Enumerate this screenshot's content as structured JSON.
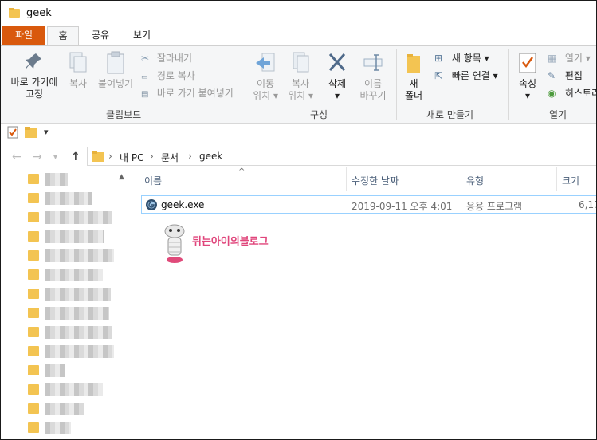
{
  "window": {
    "title": "geek"
  },
  "tabs": {
    "file": "파일",
    "home": "홈",
    "share": "공유",
    "view": "보기"
  },
  "ribbon": {
    "clipboard": {
      "pin_line1": "바로 가기에",
      "pin_line2": "고정",
      "copy": "복사",
      "paste": "붙여넣기",
      "cut": "잘라내기",
      "copy_path": "경로 복사",
      "paste_shortcut": "바로 가기 붙여넣기",
      "label": "클립보드"
    },
    "organize": {
      "move_line1": "이동",
      "move_line2": "위치",
      "copyto_line1": "복사",
      "copyto_line2": "위치",
      "delete": "삭제",
      "rename_line1": "이름",
      "rename_line2": "바꾸기",
      "label": "구성"
    },
    "new": {
      "folder_line1": "새",
      "folder_line2": "폴더",
      "new_item": "새 항목",
      "easy_access": "빠른 연결",
      "label": "새로 만들기"
    },
    "open": {
      "properties": "속성",
      "open": "열기",
      "edit": "편집",
      "history": "히스토리",
      "label": "열기"
    }
  },
  "address": {
    "crumbs": [
      "내 PC",
      "문서",
      "geek"
    ]
  },
  "columns": {
    "name": "이름",
    "modified": "수정한 날짜",
    "type": "유형",
    "size": "크기"
  },
  "files": [
    {
      "name": "geek.exe",
      "modified": "2019-09-11 오후 4:01",
      "type": "응용 프로그램",
      "size": "6,17"
    }
  ],
  "watermark": "뒤는아이의블로그",
  "colors": {
    "file_tab": "#d9590d",
    "folder": "#f3c452",
    "selection_border": "#99d1ff"
  }
}
